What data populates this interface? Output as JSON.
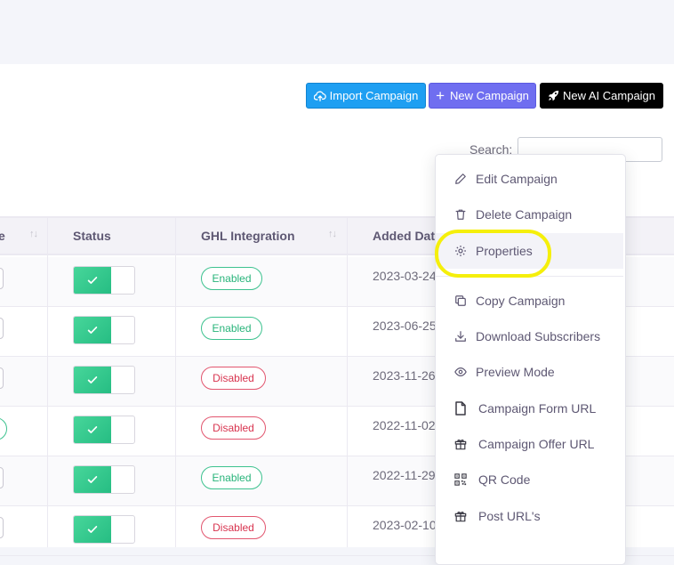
{
  "toolbar": {
    "import_label": "Import Campaign",
    "new_label": "New Campaign",
    "new_ai_label": "New AI Campaign"
  },
  "search": {
    "label": "Search:",
    "value": ""
  },
  "table": {
    "columns": [
      {
        "label": "e"
      },
      {
        "label": "Status"
      },
      {
        "label": "GHL Integration"
      },
      {
        "label": "Added Dat"
      }
    ],
    "rows": [
      {
        "status_on": true,
        "ghl": "Enabled",
        "added": "2023-03-24"
      },
      {
        "status_on": true,
        "ghl": "Enabled",
        "added": "2023-06-25"
      },
      {
        "status_on": true,
        "ghl": "Disabled",
        "added": "2023-11-26"
      },
      {
        "status_on": true,
        "ghl": "Disabled",
        "added": "2022-11-02"
      },
      {
        "status_on": true,
        "ghl": "Enabled",
        "added": "2022-11-29"
      },
      {
        "status_on": true,
        "ghl": "Disabled",
        "added": "2023-02-10"
      }
    ]
  },
  "dropdown": {
    "items": [
      {
        "label": "Edit Campaign",
        "icon": "edit-icon"
      },
      {
        "label": "Delete Campaign",
        "icon": "trash-icon"
      },
      {
        "label": "Properties",
        "icon": "gear-icon",
        "highlighted": true
      },
      {
        "label": "Copy Campaign",
        "icon": "copy-icon"
      },
      {
        "label": "Download Subscribers",
        "icon": "download-icon"
      },
      {
        "label": "Preview Mode",
        "icon": "eye-icon"
      },
      {
        "label": "Campaign Form URL",
        "icon": "file-icon"
      },
      {
        "label": "Campaign Offer URL",
        "icon": "gift-icon"
      },
      {
        "label": "QR Code",
        "icon": "qr-code-icon"
      },
      {
        "label": "Post URL's",
        "icon": "gift-icon"
      }
    ]
  },
  "colors": {
    "import_button": "#1e9ff2",
    "new_button": "#6f6ef0",
    "ai_button": "#000000",
    "enabled": "#28b47a",
    "disabled": "#d8344f",
    "highlight_ring": "#f5ef0b"
  }
}
